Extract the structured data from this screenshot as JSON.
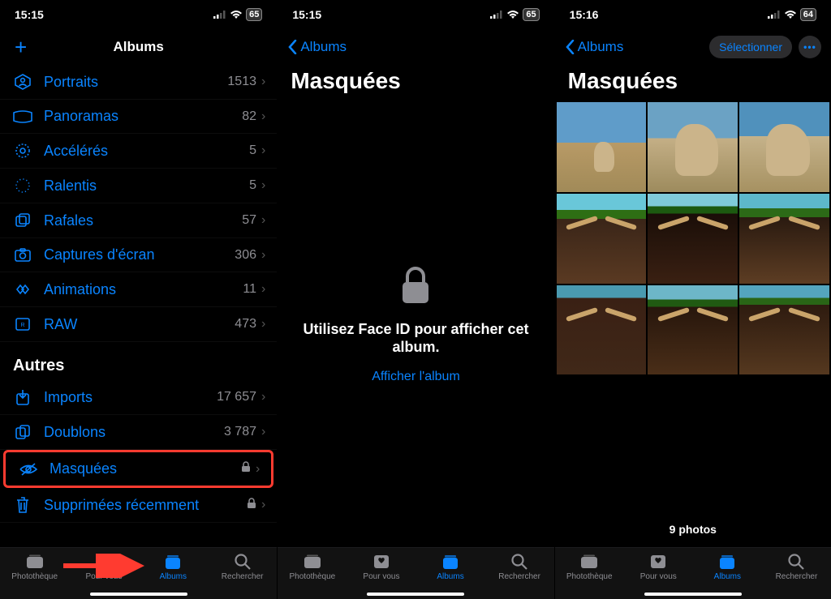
{
  "screen1": {
    "status": {
      "time": "15:15",
      "battery": "65"
    },
    "nav_title": "Albums",
    "rows_types": [
      {
        "icon": "person-crop",
        "label": "Portraits",
        "count": "1513"
      },
      {
        "icon": "pano",
        "label": "Panoramas",
        "count": "82"
      },
      {
        "icon": "timelapse",
        "label": "Accélérés",
        "count": "5"
      },
      {
        "icon": "slowmo",
        "label": "Ralentis",
        "count": "5"
      },
      {
        "icon": "burst",
        "label": "Rafales",
        "count": "57"
      },
      {
        "icon": "screenshot",
        "label": "Captures d'écran",
        "count": "306"
      },
      {
        "icon": "animation",
        "label": "Animations",
        "count": "11"
      },
      {
        "icon": "raw",
        "label": "RAW",
        "count": "473"
      }
    ],
    "section_other": "Autres",
    "rows_other": [
      {
        "icon": "import",
        "label": "Imports",
        "count": "17 657"
      },
      {
        "icon": "dup",
        "label": "Doublons",
        "count": "3 787"
      },
      {
        "icon": "hidden",
        "label": "Masquées",
        "locked": true,
        "highlight": true
      },
      {
        "icon": "trash",
        "label": "Supprimées récemment",
        "locked": true
      }
    ]
  },
  "screen2": {
    "status": {
      "time": "15:15",
      "battery": "65"
    },
    "back_label": "Albums",
    "title": "Masquées",
    "locked_message": "Utilisez Face ID pour afficher cet album.",
    "show_link": "Afficher l'album"
  },
  "screen3": {
    "status": {
      "time": "15:16",
      "battery": "64"
    },
    "back_label": "Albums",
    "title": "Masquées",
    "select_label": "Sélectionner",
    "photo_count": "9 photos"
  },
  "tabs": {
    "library": "Photothèque",
    "foryou": "Pour vous",
    "albums": "Albums",
    "search": "Rechercher"
  }
}
